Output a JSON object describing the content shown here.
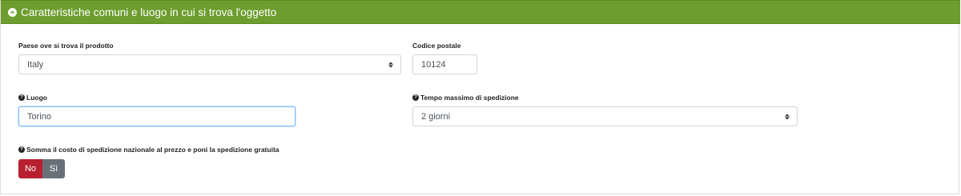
{
  "section": {
    "title": "Caratteristiche comuni e luogo in cui si trova l'oggetto",
    "collapse_icon": "chevron-up-circle-icon",
    "header_color": "#6d9d2e"
  },
  "fields": {
    "country": {
      "label": "Paese ove si trova il prodotto",
      "value": "Italy"
    },
    "postal_code": {
      "label": "Codice postale",
      "value": "10124"
    },
    "place": {
      "label": "Luogo",
      "value": "Torino",
      "help_icon": "question-circle-icon"
    },
    "shipping_time": {
      "label": "Tempo massimo di spedizione",
      "value": "2 giorni",
      "help_icon": "question-circle-icon"
    },
    "add_shipping": {
      "label": "Somma il costo di spedizione nazionale al prezzo e poni la spedizione gratuita",
      "help_icon": "question-circle-icon",
      "options": {
        "no": "No",
        "si": "Sì"
      },
      "selected": "No",
      "colors": {
        "no": "#b8202f",
        "si": "#6a7077"
      }
    }
  }
}
